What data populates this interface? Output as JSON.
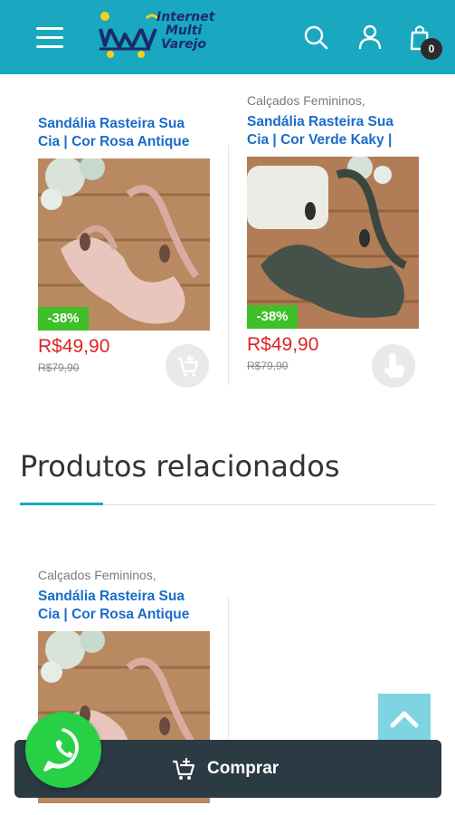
{
  "header": {
    "logo_text": [
      "Internet",
      "Multi",
      "Varejo"
    ],
    "cart_count": "0",
    "colors": {
      "bar": "#19a8bf"
    }
  },
  "products": [
    {
      "category": "",
      "title_line1": "Sandália Rasteira Sua",
      "title_line2": "Cia | Cor Rosa Antique",
      "discount": "-38%",
      "price": "R$49,90",
      "old_price": "R$79,90"
    },
    {
      "category": "Calçados Femininos,",
      "title_line1": "Sandália Rasteira Sua",
      "title_line2": "Cia | Cor Verde Kaky |",
      "discount": "-38%",
      "price": "R$49,90",
      "old_price": "R$79,90"
    }
  ],
  "related": {
    "heading": "Produtos relacionados",
    "items": [
      {
        "category": "Calçados Femininos,",
        "title_line1": "Sandália Rasteira Sua",
        "title_line2": "Cia | Cor Rosa Antique"
      }
    ]
  },
  "buy_bar": {
    "label": "Comprar"
  },
  "icons": [
    "menu-icon",
    "search-icon",
    "user-icon",
    "shopping-bag-icon",
    "add-to-cart-icon",
    "hand-pointer-icon",
    "chevron-up-icon",
    "whatsapp-icon",
    "cart-plus-icon"
  ]
}
